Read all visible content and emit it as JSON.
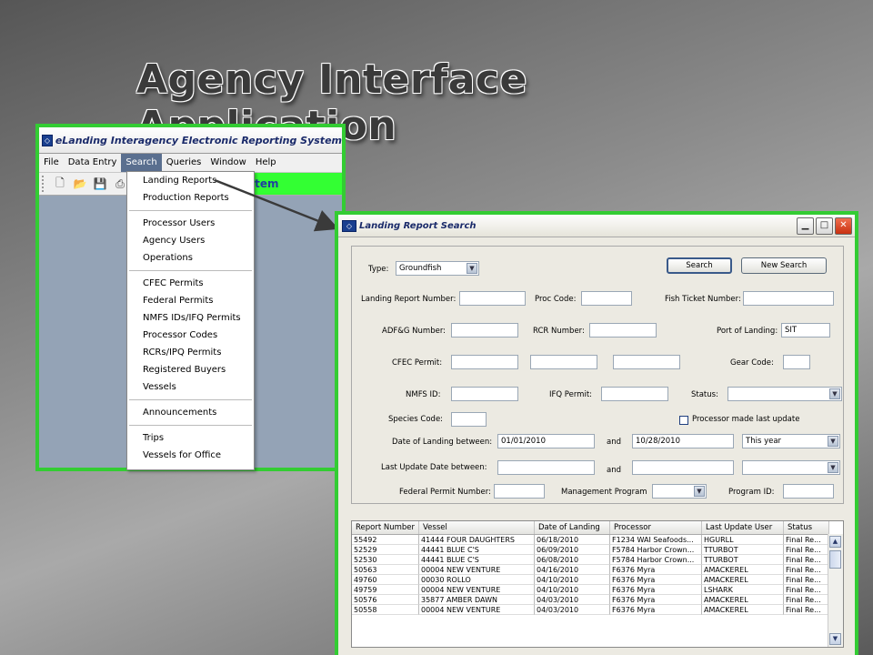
{
  "slide": {
    "title": "Agency Interface Application"
  },
  "main_window": {
    "title": "eLanding Interagency Electronic Reporting System",
    "menu": [
      "File",
      "Data Entry",
      "Search",
      "Queries",
      "Window",
      "Help"
    ],
    "active_menu": "Search",
    "banner": "stem",
    "search_menu": {
      "groups": [
        [
          "Landing Reports",
          "Production Reports"
        ],
        [
          "Processor Users",
          "Agency Users",
          "Operations"
        ],
        [
          "CFEC Permits",
          "Federal Permits",
          "NMFS IDs/IFQ Permits",
          "Processor Codes",
          "RCRs/IPQ Permits",
          "Registered Buyers",
          "Vessels"
        ],
        [
          "Announcements"
        ],
        [
          "Trips",
          "Vessels for Office"
        ]
      ]
    }
  },
  "dialog": {
    "title": "Landing Report Search",
    "buttons": {
      "search": "Search",
      "new_search": "New Search"
    },
    "labels": {
      "type": "Type:",
      "landing_report_number": "Landing Report Number:",
      "proc_code": "Proc Code:",
      "fish_ticket_number": "Fish Ticket Number:",
      "adfg_number": "ADF&G Number:",
      "rcr_number": "RCR Number:",
      "port_of_landing": "Port of Landing:",
      "cfec_permit": "CFEC Permit:",
      "gear_code": "Gear Code:",
      "nmfs_id": "NMFS ID:",
      "ifq_permit": "IFQ Permit:",
      "status": "Status:",
      "species_code": "Species Code:",
      "processor_made_last_update": "Processor made last update",
      "date_of_landing_between": "Date of Landing  between:",
      "and_1": "and",
      "last_update_date_between": "Last Update Date  between:",
      "and_2": "and",
      "federal_permit_number": "Federal Permit Number:",
      "management_program": "Management Program",
      "program_id": "Program ID:"
    },
    "values": {
      "type": "Groundfish",
      "port_of_landing": "SIT",
      "date_from": "01/01/2010",
      "date_to": "10/28/2010",
      "date_range": "This year"
    },
    "grid": {
      "columns": [
        "Report Number",
        "Vessel",
        "Date of Landing",
        "Processor",
        "Last Update User",
        "Status"
      ],
      "rows": [
        [
          "55492",
          "41444 FOUR DAUGHTERS",
          "06/18/2010",
          "F1234 WAI Seafoods...",
          "HGURLL",
          "Final Re..."
        ],
        [
          "52529",
          "44441 BLUE C'S",
          "06/09/2010",
          "F5784 Harbor Crown...",
          "TTURBOT",
          "Final Re..."
        ],
        [
          "52530",
          "44441 BLUE C'S",
          "06/08/2010",
          "F5784 Harbor Crown...",
          "TTURBOT",
          "Final Re..."
        ],
        [
          "50563",
          "00004 NEW VENTURE",
          "04/16/2010",
          "F6376 Myra",
          "AMACKEREL",
          "Final Re..."
        ],
        [
          "49760",
          "00030 ROLLO",
          "04/10/2010",
          "F6376 Myra",
          "AMACKEREL",
          "Final Re..."
        ],
        [
          "49759",
          "00004 NEW VENTURE",
          "04/10/2010",
          "F6376 Myra",
          "LSHARK",
          "Final Re..."
        ],
        [
          "50576",
          "35877 AMBER DAWN",
          "04/03/2010",
          "F6376 Myra",
          "AMACKEREL",
          "Final Re..."
        ],
        [
          "50558",
          "00004 NEW VENTURE",
          "04/03/2010",
          "F6376 Myra",
          "AMACKEREL",
          "Final Re..."
        ]
      ]
    }
  }
}
